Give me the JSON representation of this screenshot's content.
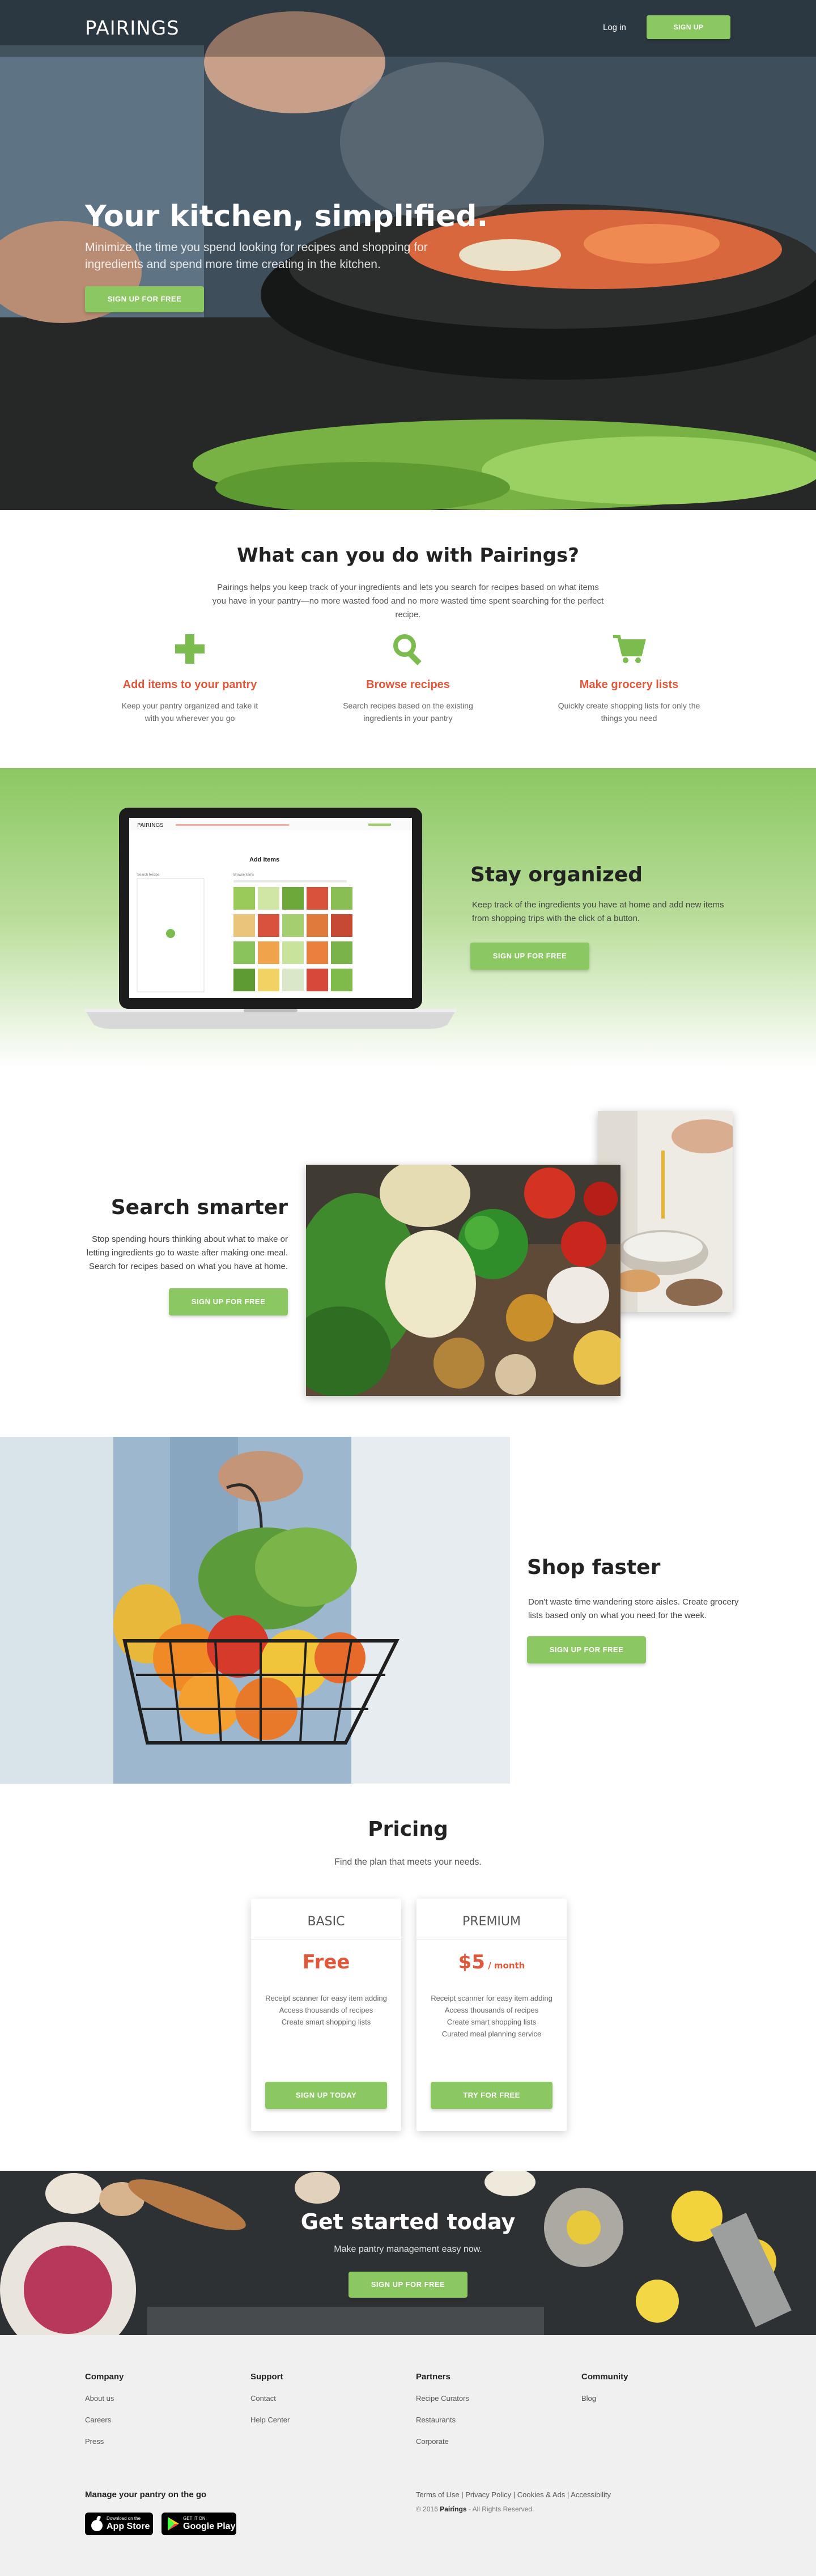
{
  "brand": "PAIRINGS",
  "nav": {
    "login": "Log in",
    "signup": "SIGN UP"
  },
  "hero": {
    "title": "Your kitchen, simplified.",
    "subtitle": "Minimize the time you spend looking for recipes and shopping for ingredients and spend more time creating in the kitchen.",
    "cta": "SIGN UP FOR FREE"
  },
  "features": {
    "title": "What can you do with Pairings?",
    "intro": "Pairings helps you keep track of your ingredients and lets you search for recipes based on what items you have in your pantry—no more wasted food and no more wasted time spent searching for the perfect recipe.",
    "items": [
      {
        "icon": "plus-icon",
        "title": "Add items to your pantry",
        "desc": "Keep your pantry organized and take it with you wherever you go"
      },
      {
        "icon": "search-icon",
        "title": "Browse recipes",
        "desc": "Search recipes based on the existing ingredients in your pantry"
      },
      {
        "icon": "cart-icon",
        "title": "Make grocery lists",
        "desc": "Quickly create shopping lists for only the things you need"
      }
    ]
  },
  "organized": {
    "title": "Stay organized",
    "desc": "Keep track of the ingredients you have at home and add new items from shopping trips with the click of a button.",
    "cta": "SIGN UP FOR FREE",
    "screen": {
      "logo": "PAIRINGS",
      "heading": "Add Items",
      "search_label": "Search Recipe",
      "browse_label": "Browse items"
    }
  },
  "search": {
    "title": "Search smarter",
    "desc": "Stop spending hours thinking about what to make or letting ingredients go to waste after making one meal. Search for recipes based on what you have at home.",
    "cta": "SIGN UP FOR FREE"
  },
  "shop": {
    "title": "Shop faster",
    "desc": "Don't waste time wandering store aisles. Create grocery lists based only on what you need for the week.",
    "cta": "SIGN UP FOR FREE"
  },
  "pricing": {
    "title": "Pricing",
    "subtitle": "Find the plan that meets your needs.",
    "plans": [
      {
        "name": "BASIC",
        "price": "Free",
        "per": "",
        "features": [
          "Receipt scanner for easy item adding",
          "Access thousands of recipes",
          "Create smart shopping lists"
        ],
        "cta": "SIGN UP TODAY"
      },
      {
        "name": "PREMIUM",
        "price": "$5",
        "per": " / month",
        "features": [
          "Receipt scanner for easy item adding",
          "Access thousands of recipes",
          "Create smart shopping lists",
          "Curated meal planning service"
        ],
        "cta": "TRY FOR FREE"
      }
    ]
  },
  "started": {
    "title": "Get started today",
    "subtitle": "Make pantry management easy now.",
    "cta": "SIGN UP FOR FREE"
  },
  "footer": {
    "columns": [
      {
        "heading": "Company",
        "links": [
          "About us",
          "Careers",
          "Press"
        ]
      },
      {
        "heading": "Support",
        "links": [
          "Contact",
          "Help Center"
        ]
      },
      {
        "heading": "Partners",
        "links": [
          "Recipe Curators",
          "Restaurants",
          "Corporate"
        ]
      },
      {
        "heading": "Community",
        "links": [
          "Blog"
        ]
      }
    ],
    "manage": "Manage your pantry on the go",
    "app_store": {
      "small": "Download on the",
      "big": "App Store"
    },
    "google_play": {
      "small": "GET IT ON",
      "big": "Google Play"
    },
    "legal_links": [
      "Terms of Use",
      "Privacy Policy",
      "Cookies & Ads",
      "Accessibility"
    ],
    "copyright_prefix": "© 2016",
    "copyright_brand": "Pairings",
    "copyright_suffix": "- All Rights Reserved."
  },
  "colors": {
    "accent_green": "#8cc862",
    "accent_red": "#e2563a",
    "footer_bg": "#f0f0f0"
  }
}
